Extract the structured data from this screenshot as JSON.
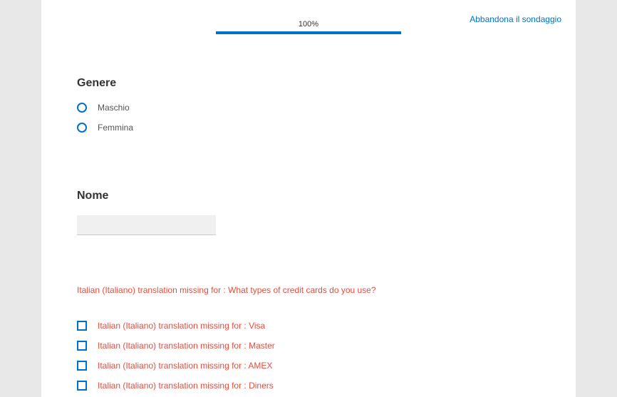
{
  "abandon_text": "Abbandona il sondaggio",
  "progress": {
    "label": "100%"
  },
  "questions": {
    "q1": {
      "title": "Genere",
      "options": [
        "Maschio",
        "Femmina"
      ]
    },
    "q2": {
      "title": "Nome"
    },
    "q3": {
      "title": "Italian (Italiano) translation missing for : What types of credit cards do you use?",
      "options": [
        "Italian (Italiano) translation missing for : Visa",
        "Italian (Italiano) translation missing for : Master",
        "Italian (Italiano) translation missing for : AMEX",
        "Italian (Italiano) translation missing for : Diners"
      ]
    }
  }
}
